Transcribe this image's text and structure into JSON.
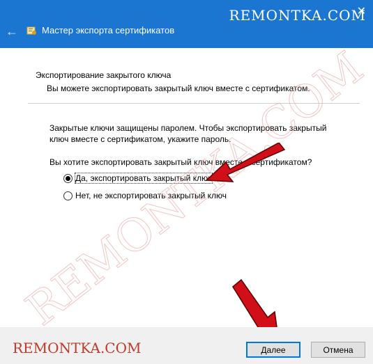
{
  "window": {
    "watermark_top": "REMONTKA.COM",
    "close_glyph": "✕",
    "back_glyph": "←",
    "title": "Мастер экспорта сертификатов"
  },
  "section": {
    "title": "Экспортирование закрытого ключа",
    "subtitle": "Вы можете экспортировать закрытый ключ вместе с сертификатом."
  },
  "body": {
    "paragraph": "Закрытые ключи защищены паролем. Чтобы экспортировать закрытый ключ вместе с сертификатом, укажите пароль.",
    "question": "Вы хотите экспортировать закрытый ключ вместе с сертификатом?"
  },
  "options": [
    {
      "label": "Да, экспортировать закрытый ключ",
      "selected": true
    },
    {
      "label": "Нет, не экспортировать закрытый ключ",
      "selected": false
    }
  ],
  "footer": {
    "watermark": "REMONTKA.COM",
    "next_label": "Далее",
    "cancel_label": "Отмена"
  },
  "watermark_big": "REMONTKA.COM",
  "colors": {
    "titlebar": "#1a76d1",
    "accent_border": "#0078d7",
    "arrow": "#d10f18"
  }
}
